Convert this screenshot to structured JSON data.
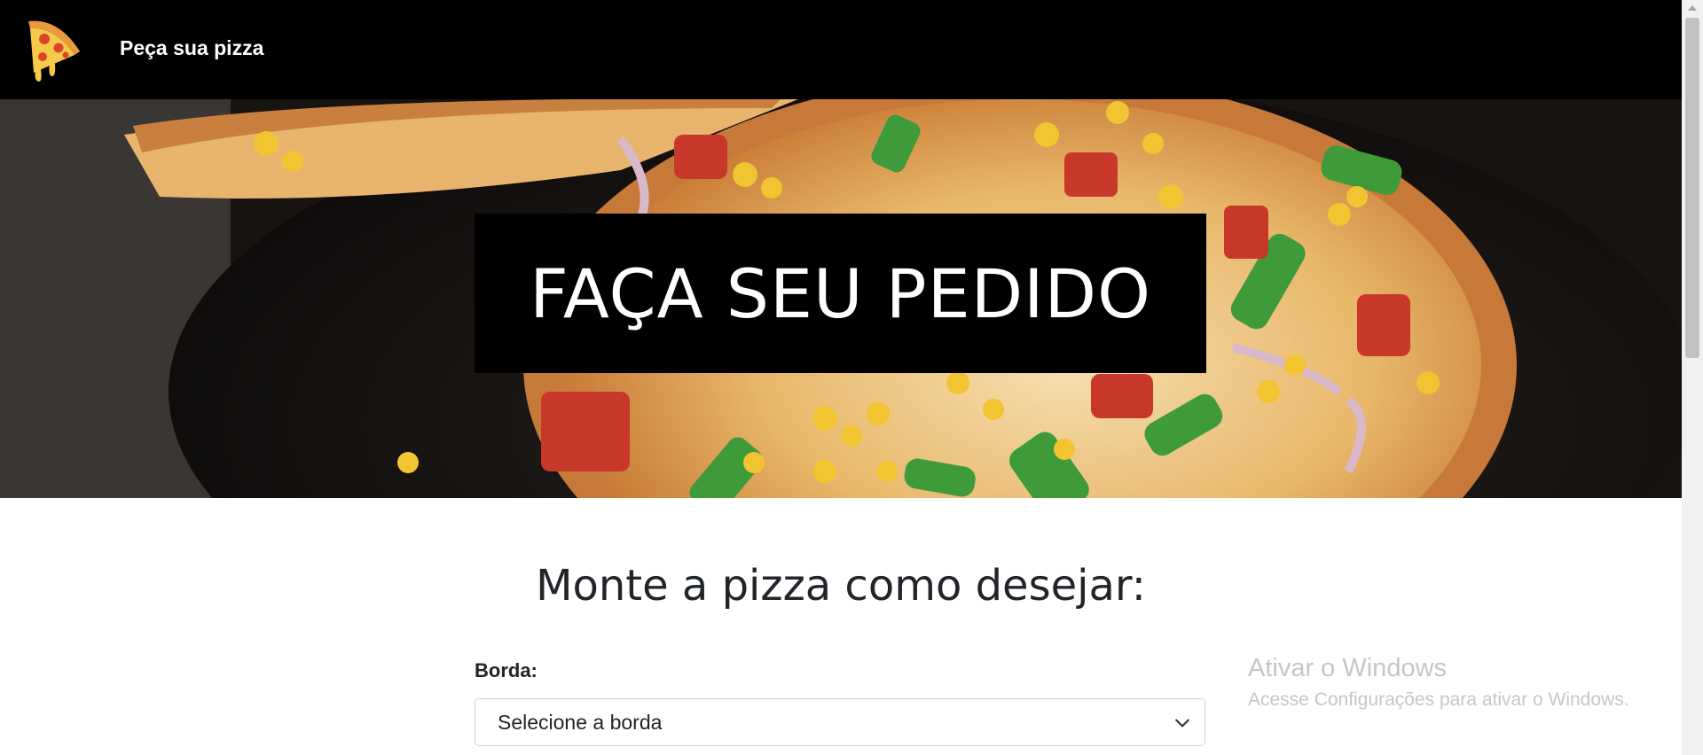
{
  "navbar": {
    "brand_text": "Peça sua pizza",
    "logo_icon": "pizza-slice-icon"
  },
  "hero": {
    "title": "FAÇA SEU PEDIDO"
  },
  "form": {
    "heading": "Monte a pizza como desejar:",
    "borda_label": "Borda:",
    "borda_select_value": "Selecione a borda"
  },
  "watermark": {
    "title": "Ativar o Windows",
    "subtitle": "Acesse Configurações para ativar o Windows."
  },
  "colors": {
    "navbar_bg": "#000000",
    "hero_box_bg": "#000000",
    "text": "#212529"
  }
}
